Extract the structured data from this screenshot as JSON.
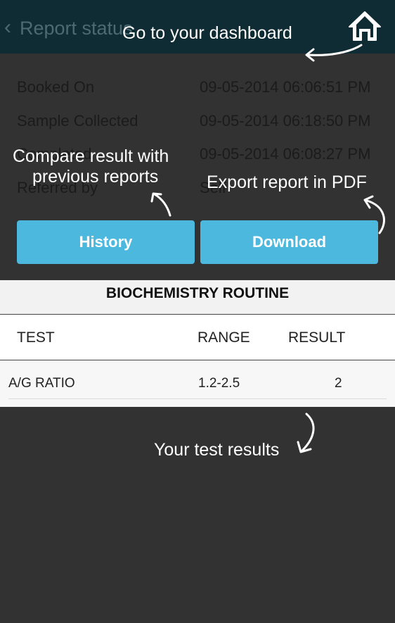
{
  "topbar": {
    "back_glyph": "‹",
    "title": "Report status",
    "home_icon": "home-icon"
  },
  "report_info": [
    {
      "label": "Booked On",
      "value": "09-05-2014 06:06:51 PM"
    },
    {
      "label": "Sample Collected",
      "value": "09-05-2014 06:18:50 PM"
    },
    {
      "label": "Completed",
      "value": "09-05-2014 06:08:27 PM"
    },
    {
      "label": "Referred by",
      "value": "Self"
    }
  ],
  "buttons": {
    "history": "History",
    "download": "Download"
  },
  "results": {
    "section_title": "BIOCHEMISTRY ROUTINE",
    "columns": [
      "TEST",
      "RANGE",
      "RESULT"
    ],
    "rows": [
      {
        "test": "A/G RATIO",
        "range": "1.2-2.5",
        "result": "2"
      }
    ]
  },
  "tutorial": {
    "dashboard_hint": "Go to your dashboard",
    "compare_hint_line1": "Compare result with",
    "compare_hint_line2": "previous reports",
    "export_hint": "Export report in PDF",
    "results_hint": "Your test results"
  },
  "colors": {
    "overlay": "#323232",
    "topbar": "#0f2b33",
    "button": "#4cb8de"
  }
}
